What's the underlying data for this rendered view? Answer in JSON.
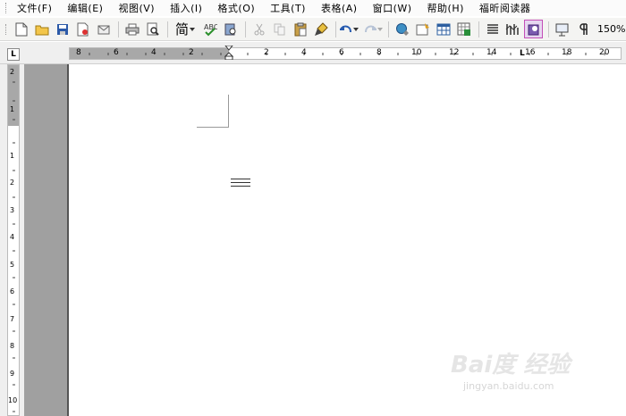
{
  "menu": [
    "文件(F)",
    "编辑(E)",
    "视图(V)",
    "插入(I)",
    "格式(O)",
    "工具(T)",
    "表格(A)",
    "窗口(W)",
    "帮助(H)",
    "福昕阅读器"
  ],
  "toolbar": {
    "font_label": "简",
    "zoom": "150%"
  },
  "ruler": {
    "tab_marker": "L",
    "h_labels_left": [
      "8",
      "6",
      "4",
      "2"
    ],
    "h_labels_right": [
      "2",
      "4",
      "6",
      "8",
      "10",
      "12",
      "14",
      "16",
      "18",
      "20"
    ],
    "v_labels_top": [
      "2",
      "1"
    ],
    "v_labels": [
      "1",
      "2",
      "3",
      "4",
      "5",
      "6",
      "7",
      "8",
      "9",
      "10"
    ]
  },
  "watermark": {
    "logo": "Bai度 经验",
    "url": "jingyan.baidu.com"
  }
}
